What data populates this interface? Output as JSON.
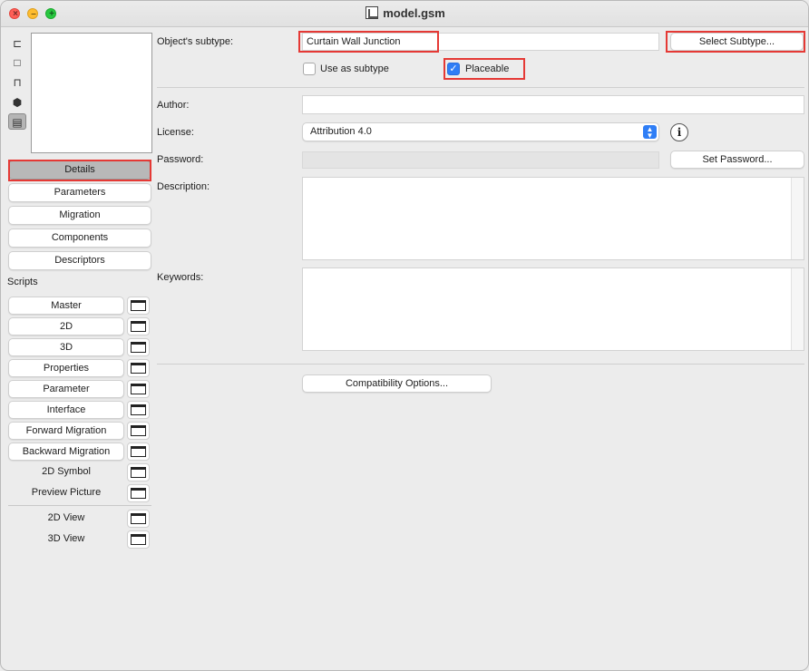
{
  "window": {
    "title": "model.gsm"
  },
  "sidebar": {
    "nav": [
      {
        "label": "Details",
        "active": true
      },
      {
        "label": "Parameters"
      },
      {
        "label": "Migration"
      },
      {
        "label": "Components"
      },
      {
        "label": "Descriptors"
      }
    ],
    "scripts_label": "Scripts",
    "scripts": [
      {
        "label": "Master"
      },
      {
        "label": "2D"
      },
      {
        "label": "3D"
      },
      {
        "label": "Properties"
      },
      {
        "label": "Parameter"
      },
      {
        "label": "Interface"
      },
      {
        "label": "Forward Migration"
      },
      {
        "label": "Backward Migration"
      }
    ],
    "other": [
      {
        "label": "2D Symbol"
      },
      {
        "label": "Preview Picture"
      }
    ],
    "views": [
      {
        "label": "2D View"
      },
      {
        "label": "3D View"
      }
    ]
  },
  "details": {
    "subtype_label": "Object's subtype:",
    "subtype_value": "Curtain Wall Junction",
    "select_subtype_button": "Select Subtype...",
    "use_as_subtype_label": "Use as subtype",
    "use_as_subtype_checked": false,
    "placeable_label": "Placeable",
    "placeable_checked": true,
    "author_label": "Author:",
    "author_value": "",
    "license_label": "License:",
    "license_value": "Attribution 4.0",
    "password_label": "Password:",
    "password_value": "",
    "set_password_button": "Set Password...",
    "description_label": "Description:",
    "description_value": "",
    "keywords_label": "Keywords:",
    "keywords_value": "",
    "compatibility_button": "Compatibility Options..."
  },
  "colors": {
    "highlight": "#e53935",
    "accent": "#2f7ef6"
  }
}
